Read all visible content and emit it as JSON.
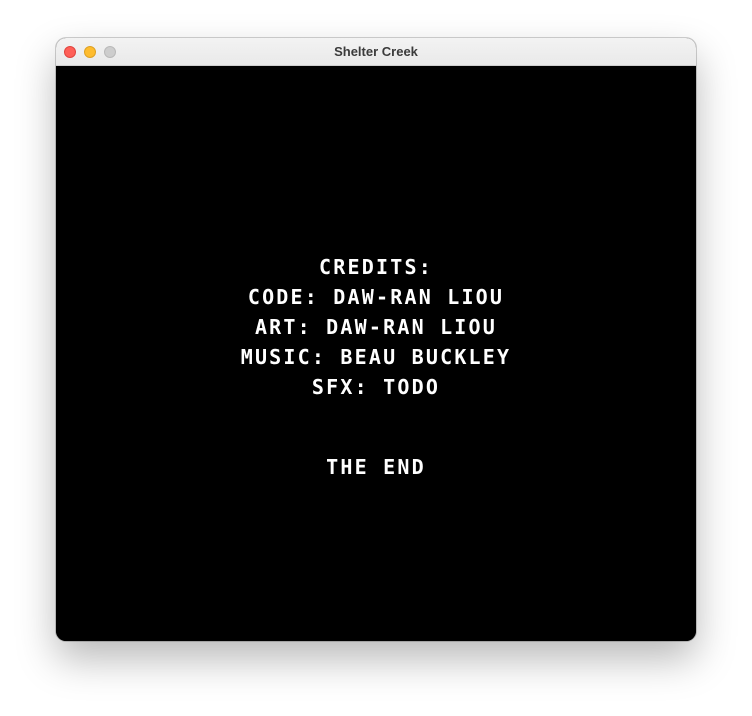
{
  "window": {
    "title": "Shelter Creek"
  },
  "game": {
    "background_color": "#000000",
    "text_color": "#ffffff",
    "credits_heading": "CREDITS:",
    "credits": [
      "CODE: DAW-RAN LIOU",
      "ART: DAW-RAN LIOU",
      "MUSIC: BEAU BUCKLEY",
      "SFX: TODO"
    ],
    "ending": "THE END"
  }
}
